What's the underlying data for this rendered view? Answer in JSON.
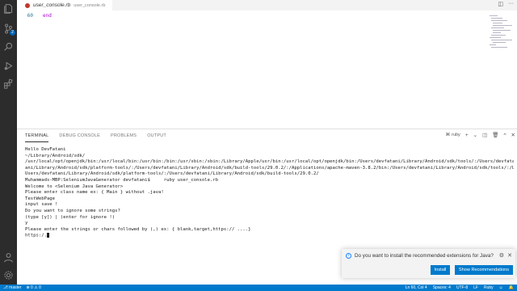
{
  "editor_tab": {
    "title": "user_console.rb",
    "description": "user_console.rb",
    "actions": [
      "split-editor-icon",
      "more-actions-icon"
    ]
  },
  "editor": {
    "line_number": "60",
    "code": "end"
  },
  "activity_bar": {
    "items": [
      "explorer-icon",
      "source-control-icon",
      "search-icon",
      "run-debug-icon",
      "extensions-icon"
    ],
    "source_control_badge": "2",
    "bottom": [
      "account-icon",
      "manage-gear-icon"
    ]
  },
  "panel": {
    "tabs": [
      "TERMINAL",
      "DEBUG CONSOLE",
      "PROBLEMS",
      "OUTPUT"
    ],
    "active_tab": "TERMINAL",
    "terminal_name": "ruby",
    "terminal_lines": [
      "Hello DevFatani",
      "~/Library/Android/sdk/",
      "/usr/local/opt/openjdk/bin:/usr/local/bin:/usr/bin:/bin:/usr/sbin:/sbin:/Library/Apple/usr/bin:/usr/local/opt/openjdk/bin:/Users/devfatani/Library/Android/sdk/tools/:/Users/devfatani/Libr",
      "ani/Library/Android/sdk/platform-tools/:/Users/devfatani/Library/Android/sdk/build-tools/29.0.2/:/Applications/apache-maven-3.8.2/bin:/Users/devfatani/Library/Android/sdk/tools/:/Users/devfatan",
      "Users/devfatani/Library/Android/sdk/platform-tools/:/Users/devfatani/Library/Android/sdk/build-tools/29.0.2/",
      "Muhammads-MBP:SeleniumJavaGenerator devfatani$     ruby user_console.rb",
      "Welcome to <Selenium Java Generator>",
      "Please enter class name ex: { Main } without .java!",
      "TestWebPage",
      "input save !",
      "Do you want to ignore some strings?",
      "(type [y]) | (enter for ignore !)",
      "y",
      "Please enter the strings or chars followed by (,) ex: { blank,target,https:// ....}"
    ],
    "prompt_input": "https:/."
  },
  "notification": {
    "message": "Do you want to install the recommended extensions for Java?",
    "install_label": "Install",
    "show_label": "Show Recommendations"
  },
  "status_bar": {
    "branch": "master",
    "errors": "0",
    "warnings": "0",
    "cursor": "Ln 60, Col 4",
    "spaces": "Spaces: 4",
    "encoding": "UTF-8",
    "eol": "LF",
    "language": "Ruby"
  },
  "colors": {
    "status_bar": "#007acc",
    "activity_bar": "#2c2c2c",
    "button": "#007acc"
  }
}
